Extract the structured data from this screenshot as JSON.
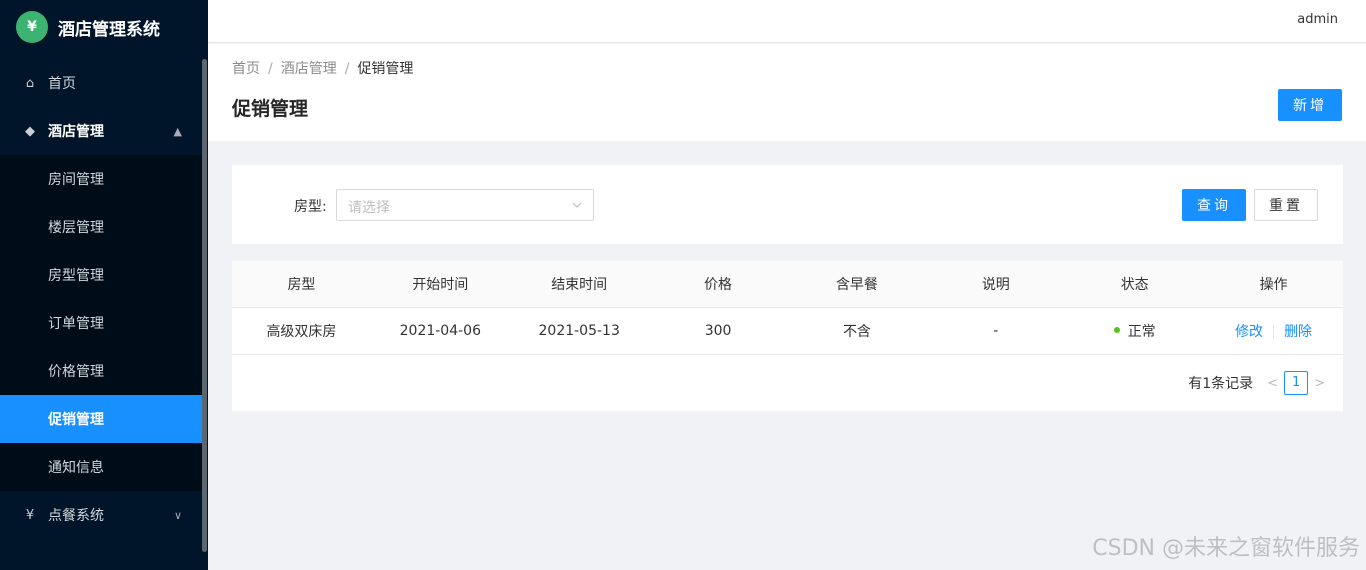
{
  "app": {
    "title": "酒店管理系统",
    "logo_glyph": "¥"
  },
  "header": {
    "user": "admin"
  },
  "sidebar": {
    "items": [
      {
        "label": "首页",
        "icon": "home-icon"
      },
      {
        "label": "酒店管理",
        "icon": "diamond-icon",
        "expanded": true
      },
      {
        "label": "点餐系统",
        "icon": "receipt-icon",
        "expanded": false
      }
    ],
    "submenu": [
      {
        "label": "房间管理"
      },
      {
        "label": "楼层管理"
      },
      {
        "label": "房型管理"
      },
      {
        "label": "订单管理"
      },
      {
        "label": "价格管理"
      },
      {
        "label": "促销管理",
        "active": true
      },
      {
        "label": "通知信息"
      }
    ]
  },
  "breadcrumb": [
    "首页",
    "酒店管理",
    "促销管理"
  ],
  "page": {
    "title": "促销管理",
    "add_button": "新增"
  },
  "search": {
    "label": "房型:",
    "placeholder": "请选择",
    "query_button": "查询",
    "reset_button": "重置"
  },
  "table": {
    "columns": [
      "房型",
      "开始时间",
      "结束时间",
      "价格",
      "含早餐",
      "说明",
      "状态",
      "操作"
    ],
    "rows": [
      {
        "room_type": "高级双床房",
        "start": "2021-04-06",
        "end": "2021-05-13",
        "price": "300",
        "breakfast": "不含",
        "note": "-",
        "status": "正常",
        "edit": "修改",
        "delete": "删除"
      }
    ]
  },
  "pagination": {
    "total_text": "有1条记录",
    "current": "1"
  },
  "watermark": "CSDN @未来之窗软件服务",
  "colors": {
    "primary": "#1890ff",
    "sidebar": "#001529",
    "status_ok": "#52c41a",
    "logo": "#3cb371"
  }
}
